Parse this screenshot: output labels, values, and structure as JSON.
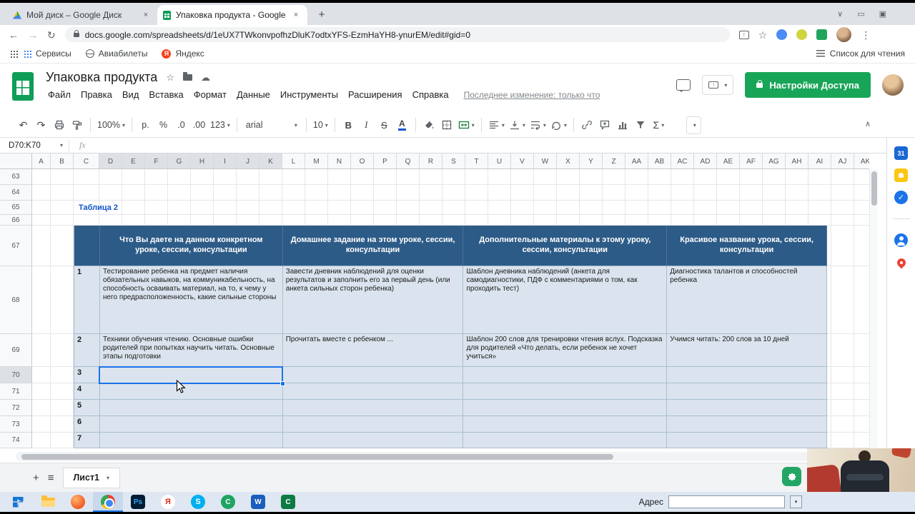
{
  "icons": {
    "dropdown": "▾",
    "star": "☆",
    "kebab": "⋮",
    "plus": "+",
    "hamburger": "≡",
    "close": "×",
    "chevron_down": "∨",
    "min_box": "▭",
    "max_box": "▣",
    "back": "←",
    "forward": "→",
    "reload": "↻",
    "undo": "↶",
    "redo": "↷",
    "cloud": "☁",
    "check": "✓",
    "sigma": "Σ",
    "collapse": "∧",
    "up_arrow": "↑"
  },
  "browser": {
    "tabs": [
      {
        "title": "Мой диск – Google Диск"
      },
      {
        "title": "Упаковка продукта - Google Таб"
      }
    ],
    "url": "docs.google.com/spreadsheets/d/1eUX7TWkonvpofhzDluK7odtxYFS-EzmHaYH8-ynurEM/edit#gid=0",
    "bookmarks": [
      {
        "label": "Сервисы"
      },
      {
        "label": "Авиабилеты"
      },
      {
        "label": "Яндекс"
      }
    ],
    "reading_list": "Список для чтения"
  },
  "app": {
    "title": "Упаковка продукта",
    "menus": [
      {
        "label": "Файл"
      },
      {
        "label": "Правка"
      },
      {
        "label": "Вид"
      },
      {
        "label": "Вставка"
      },
      {
        "label": "Формат"
      },
      {
        "label": "Данные"
      },
      {
        "label": "Инструменты"
      },
      {
        "label": "Расширения"
      },
      {
        "label": "Справка"
      }
    ],
    "last_edit": "Последнее изменение: только что",
    "share_button": "Настройки Доступа"
  },
  "toolbar": {
    "zoom": "100%",
    "currency": "р.",
    "percent": "%",
    "decimal_decrease": ".0",
    "decimal_increase": ".00",
    "number_format": "123",
    "font": "arial",
    "font_size": "10",
    "bold": "B",
    "italic": "I",
    "strikethrough": "S",
    "text_color": "A"
  },
  "formula_bar": {
    "name_box": "D70:K70",
    "fx_label": "fx"
  },
  "grid": {
    "columns": [
      "A",
      "B",
      "C",
      "D",
      "E",
      "F",
      "G",
      "H",
      "I",
      "J",
      "K",
      "L",
      "M",
      "N",
      "O",
      "P",
      "Q",
      "R",
      "S",
      "T",
      "U",
      "V",
      "W",
      "X",
      "Y",
      "Z",
      "AA",
      "AB",
      "AC",
      "AD",
      "AE",
      "AF",
      "AG",
      "AH",
      "AI",
      "AJ",
      "AK"
    ],
    "rows": [
      "63",
      "64",
      "65",
      "66",
      "67",
      "68",
      "69",
      "70",
      "71",
      "72",
      "73",
      "74"
    ],
    "selected_range": "D70:K70"
  },
  "sheet_content": {
    "caption": "Таблица 2",
    "table": {
      "headers": [
        "Что Вы даете на данном конкретном уроке, сессии, консультации",
        "Домашнее задание на этом уроке, сессии, консультации",
        "Дополнительные материалы к этому уроку, сессии, консультации",
        "Красивое название урока, сессии, консультации"
      ],
      "rows": [
        {
          "num": "1",
          "cells": [
            "Тестирование ребенка на предмет наличия обязательных навыков, на коммуникабельность, на способность осваивать материал, на то, к чему у него предрасположенность, какие сильные стороны",
            "Завести дневник наблюдений для оценки результатов и заполнить его за первый день (или анкета сильных сторон ребенка)",
            "Шаблон дневника наблюдений (анкета для самодиагностики, ПДФ с комментариями о том, как проходить тест)",
            "Диагностика талантов и способностей ребенка"
          ]
        },
        {
          "num": "2",
          "cells": [
            "Техники обучения чтению. Основные ошибки родителей при попытках научить читать. Основные этапы подготовки",
            "Прочитать вместе с ребенком ...",
            "Шаблон 200 слов для тренировки чтения вслух. Подсказка для родителей «Что делать, если ребенок не хочет учиться»",
            "Учимся читать: 200 слов за 10 дней"
          ]
        },
        {
          "num": "3",
          "cells": [
            "",
            "",
            "",
            ""
          ]
        },
        {
          "num": "4",
          "cells": [
            "",
            "",
            "",
            ""
          ]
        },
        {
          "num": "5",
          "cells": [
            "",
            "",
            "",
            ""
          ]
        },
        {
          "num": "6",
          "cells": [
            "",
            "",
            "",
            ""
          ]
        },
        {
          "num": "7",
          "cells": [
            "",
            "",
            "",
            ""
          ]
        }
      ]
    }
  },
  "sheet_tabs": {
    "active_sheet": "Лист1"
  },
  "side_panel": {
    "calendar_day": "31"
  },
  "taskbar": {
    "address_label": "Адрес",
    "icon_letters": {
      "photoshop": "Ps",
      "yandex": "Я",
      "skype": "S",
      "camtasia": "C",
      "word": "W",
      "green_app": "C"
    }
  },
  "colors": {
    "table_header_bg": "#2d5b87",
    "table_body_bg": "#dbe4ee",
    "accent_blue": "#1a73e8",
    "share_green": "#18a558",
    "caption_blue": "#1155cc"
  }
}
